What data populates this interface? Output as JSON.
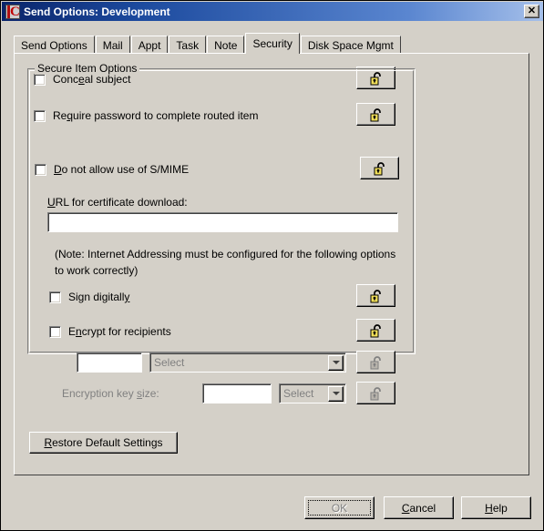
{
  "window": {
    "title": "Send Options:  Development",
    "icon": "groupwise-c-icon",
    "close_label": "✕"
  },
  "tabs": [
    {
      "label": "Send Options",
      "active": false
    },
    {
      "label": "Mail",
      "active": false
    },
    {
      "label": "Appt",
      "active": false
    },
    {
      "label": "Task",
      "active": false
    },
    {
      "label": "Note",
      "active": false
    },
    {
      "label": "Security",
      "active": true
    },
    {
      "label": "Disk Space Mgmt",
      "active": false
    }
  ],
  "options": {
    "conceal_subject": {
      "pre": "Conc",
      "key": "e",
      "post": "al subject",
      "checked": false,
      "lock": "unlocked"
    },
    "require_password": {
      "pre": "Re",
      "key": "q",
      "post": "uire password to complete routed item",
      "checked": false,
      "lock": "unlocked"
    }
  },
  "secure_group": {
    "title": "Secure Item Options",
    "no_smime": {
      "pre": "",
      "key": "D",
      "post": "o not allow use of S/MIME",
      "checked": false,
      "lock": "unlocked"
    },
    "url_label": {
      "pre": "",
      "key": "U",
      "post": "RL for certificate download:"
    },
    "url_value": "",
    "note": "(Note: Internet Addressing must be configured for the following options to work correctly)",
    "sign_digitally": {
      "pre": "Sign digitall",
      "key": "y",
      "post": "",
      "checked": false,
      "lock": "unlocked"
    },
    "encrypt_recipients": {
      "pre": "E",
      "key": "n",
      "post": "crypt for recipients",
      "checked": false,
      "lock": "unlocked"
    },
    "encrypt_value": "",
    "encrypt_select": "Select",
    "keysize_label": {
      "pre": "Encryption key ",
      "key": "s",
      "post": "ize:"
    },
    "keysize_value": "",
    "keysize_select": "Select"
  },
  "restore_button": {
    "pre": "",
    "key": "R",
    "post": "estore Default Settings"
  },
  "dialog_buttons": {
    "ok": {
      "pre": "OK",
      "key": "",
      "post": "",
      "disabled": true,
      "focused": true
    },
    "cancel": {
      "pre": "",
      "key": "C",
      "post": "ancel",
      "disabled": false,
      "focused": false
    },
    "help": {
      "pre": "",
      "key": "H",
      "post": "elp",
      "disabled": false,
      "focused": false
    }
  },
  "colors": {
    "face": "#d4d0c8",
    "title_left": "#0a246a",
    "title_right": "#a6c0ea",
    "lock_body": "#f2e05a",
    "disabled_text": "#808080"
  }
}
